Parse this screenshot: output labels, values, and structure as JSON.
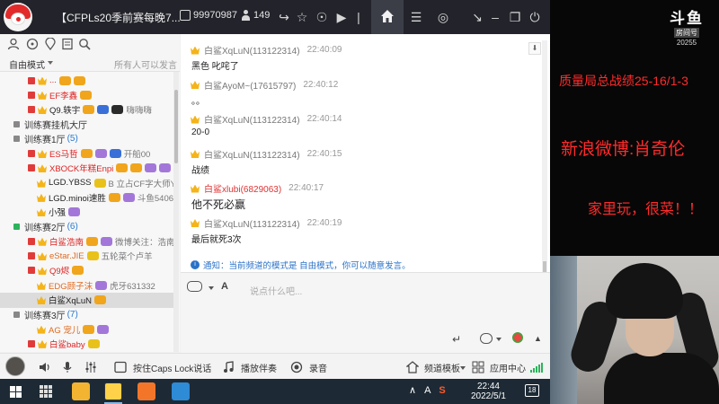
{
  "titlebar": {
    "channel_title": "【CFPLs20季前赛每晚7...",
    "channel_id": "99970987",
    "member_count": "149",
    "icons": [
      "id-icon",
      "members-icon",
      "share-icon",
      "star-icon",
      "bell-icon",
      "video-icon",
      "home-icon",
      "list-icon",
      "gamepad-icon",
      "minimize-to-tray-icon",
      "minimize-icon",
      "restore-icon",
      "power-icon"
    ]
  },
  "toolbar": {
    "icons": [
      "user-icon",
      "channel-icon",
      "location-icon",
      "bookmark-icon",
      "search-icon"
    ],
    "mode_label": "自由模式",
    "mode_desc": "所有人可以发言"
  },
  "tree": {
    "rows": [
      {
        "kind": "user",
        "mic": "V",
        "name": "...",
        "name_color": "red",
        "extra": ""
      },
      {
        "kind": "user",
        "mic": "V",
        "name": "EF李鑫",
        "name_color": "red",
        "extra": ""
      },
      {
        "kind": "user",
        "mic": "V",
        "name": "Q9.轶宇",
        "name_color": "black",
        "extra": "嗨嗨嗨"
      },
      {
        "kind": "channel",
        "name": "训练赛挂机大厅",
        "count": ""
      },
      {
        "kind": "channel",
        "name": "训练赛1厅",
        "count": "(5)"
      },
      {
        "kind": "user",
        "mic": "V",
        "name": "ES马哲",
        "name_color": "red",
        "extra": "开船00"
      },
      {
        "kind": "user",
        "mic": "V",
        "name": "XBOCK年糕Enpi",
        "name_color": "red",
        "extra": ""
      },
      {
        "kind": "user",
        "mic": "",
        "name": "LGD.YBSS",
        "name_color": "black",
        "extra": "B 立占CF字大师YB"
      },
      {
        "kind": "user",
        "mic": "",
        "name": "LGD.minoi速胜",
        "name_color": "black",
        "extra": "斗鱼5406"
      },
      {
        "kind": "user",
        "mic": "",
        "name": "小强",
        "name_color": "black",
        "extra": ""
      },
      {
        "kind": "channel",
        "name": "训练赛2厅",
        "count": "(6)"
      },
      {
        "kind": "user",
        "mic": "V",
        "name": "白鲨浩南",
        "name_color": "red",
        "extra": "微博关注：浩南一味"
      },
      {
        "kind": "user",
        "mic": "V",
        "name": "eStar.JIE",
        "name_color": "orange",
        "extra": "五轮菜个卢羊"
      },
      {
        "kind": "user",
        "mic": "V",
        "name": "Q9烬",
        "name_color": "red",
        "extra": ""
      },
      {
        "kind": "user",
        "mic": "",
        "name": "EDG顾子沫",
        "name_color": "orange",
        "extra": "虎牙631332"
      },
      {
        "kind": "user",
        "mic": "",
        "name": "白鲨XqLuN",
        "name_color": "black",
        "extra": "",
        "selected": true
      },
      {
        "kind": "channel",
        "name": "训练赛3厅",
        "count": "(7)"
      },
      {
        "kind": "user",
        "mic": "",
        "name": "AG 宠儿",
        "name_color": "orange",
        "extra": ""
      },
      {
        "kind": "user",
        "mic": "V",
        "name": "白鲨baby",
        "name_color": "red",
        "extra": ""
      }
    ]
  },
  "chat": {
    "messages": [
      {
        "name": "白鲨XqLuN(113122314)",
        "name_color": "gray",
        "time": "22:40:09",
        "text": "黑色 叱咤了"
      },
      {
        "name": "白鲨AyoM~(17615797)",
        "name_color": "gray",
        "time": "22:40:12",
        "text": "。。"
      },
      {
        "name": "白鲨XqLuN(113122314)",
        "name_color": "gray",
        "time": "22:40:14",
        "text": "20-0"
      },
      {
        "name": "白鲨XqLuN(113122314)",
        "name_color": "gray",
        "time": "22:40:15",
        "text": "战绩"
      },
      {
        "name": "白鲨xlubi(6829063)",
        "name_color": "red",
        "time": "22:40:17",
        "text": "他不死必赢"
      },
      {
        "name": "白鲨XqLuN(113122314)",
        "name_color": "gray",
        "time": "22:40:19",
        "text": "最后就死3次"
      }
    ],
    "notice": "通知：当前频道的模式是 自由模式，你可以随意发言。",
    "input_placeholder": "说点什么吧..."
  },
  "bottombar": {
    "caps_lock_label": "按住Caps Lock说话",
    "accompany_label": "播放伴奏",
    "record_label": "录音",
    "channel_template_label": "频道模板",
    "app_center_label": "应用中心",
    "icons": [
      "avatar",
      "speaker-icon",
      "microphone-icon",
      "equalizer-icon",
      "caps-key-icon",
      "music-note-icon",
      "record-icon",
      "template-icon",
      "app-center-icon",
      "signal-icon"
    ]
  },
  "overlay": {
    "logo_text": "斗鱼",
    "logo_sub": "房间号",
    "room_number": "20255",
    "line1": "质量局总战绩25-16/1-3",
    "line2": "新浪微博:肖奇伦",
    "line3": "家里玩，很菜！！"
  },
  "taskbar": {
    "tray_lang": "A",
    "time": "22:44",
    "date": "2022/5/1",
    "notification_count": "18"
  },
  "colors": {
    "titlebar_bg": "#23242b",
    "overlay_text": "#ff2b2b",
    "username_red": "#dd2222",
    "notice_blue": "#2a72c8"
  }
}
